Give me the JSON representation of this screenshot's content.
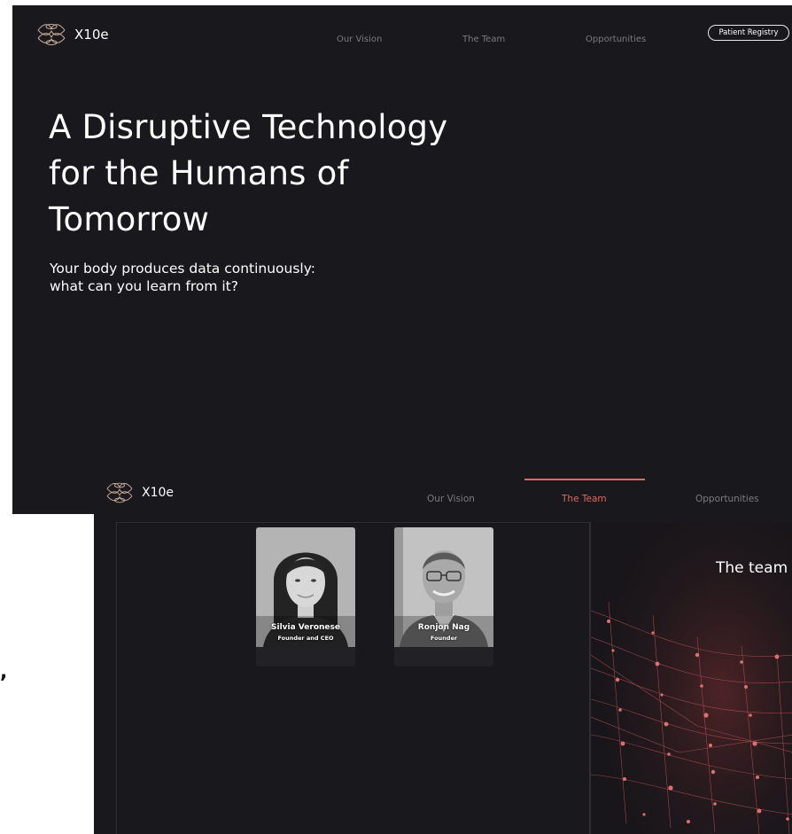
{
  "stray_mark": ",",
  "screen1": {
    "brand": {
      "name": "X10e",
      "icon": "x10e-logo-icon"
    },
    "nav": [
      {
        "label": "Our Vision"
      },
      {
        "label": "The Team"
      },
      {
        "label": "Opportunities"
      }
    ],
    "registry_button": "Patient Registry",
    "hero": {
      "title_lines": [
        "A Disruptive Technology",
        "for the Humans of",
        "Tomorrow"
      ],
      "subtitle_lines": [
        "Your body produces data continuously:",
        "what can you learn from it?"
      ]
    }
  },
  "screen2": {
    "brand": {
      "name": "X10e",
      "icon": "x10e-logo-icon"
    },
    "nav": [
      {
        "label": "Our Vision",
        "active": false
      },
      {
        "label": "The Team",
        "active": true
      },
      {
        "label": "Opportunities",
        "active": false
      }
    ],
    "team": [
      {
        "name": "Silvia Veronese",
        "role": "Founder and CEO",
        "photo": "portrait-woman"
      },
      {
        "name": "Ronjon Nag",
        "role": "Founder",
        "photo": "portrait-man-glasses"
      }
    ],
    "banner_title": "The team"
  },
  "colors": {
    "background": "#19181c",
    "accent": "#e2675f",
    "nav_text": "#7a7a80",
    "text": "#ffffff",
    "logo_stroke": "#c9ab9a"
  }
}
